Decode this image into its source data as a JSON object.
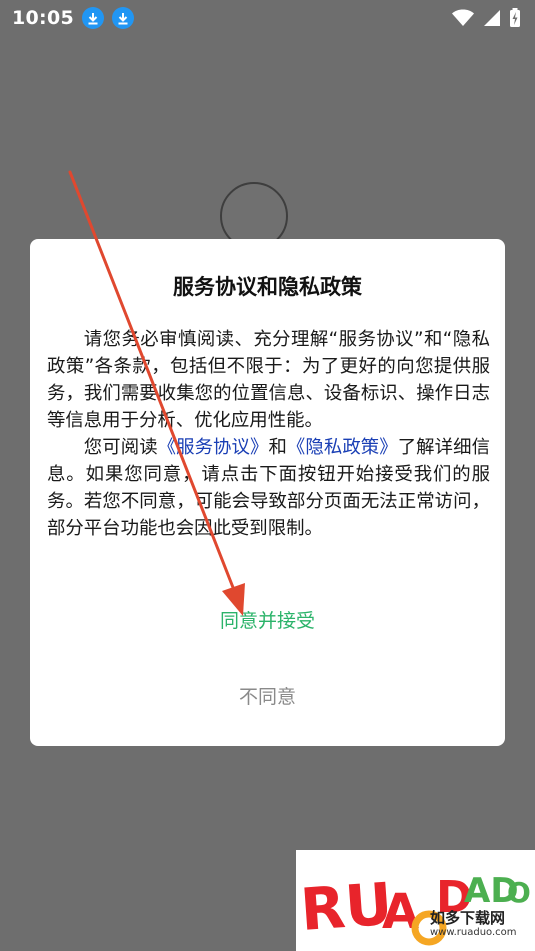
{
  "status_bar": {
    "time": "10:05",
    "left_icons": [
      "download-icon",
      "download-icon"
    ],
    "right_icons": [
      "wifi-icon",
      "signal-icon",
      "battery-charging-icon"
    ]
  },
  "dialog": {
    "title": "服务协议和隐私政策",
    "paragraph1": "请您务必审慎阅读、充分理解“服务协议”和“隐私政策”各条款，包括但不限于：为了更好的向您提供服务，我们需要收集您的位置信息、设备标识、操作日志等信息用于分析、优化应用性能。",
    "paragraph2_prefix": "您可阅读",
    "service_link": "《服务协议》",
    "paragraph2_and": "和",
    "privacy_link": "《隐私政策》",
    "paragraph2_suffix": "了解详细信息。如果您同意，请点击下面按钮开始接受我们的服务。若您不同意，可能会导致部分页面无法正常访问，部分平台功能也会因此受到限制。",
    "agree_label": "同意并接受",
    "disagree_label": "不同意"
  },
  "watermark": {
    "brand": "RUANDUO",
    "name": "如多下载网",
    "url": "www.ruaduo.com"
  },
  "colors": {
    "overlay": "#6e6e6e",
    "link": "#1a3fb5",
    "agree": "#2bb36a",
    "disagree": "#8a8a8a",
    "arrow": "#e0482f",
    "download_badge": "#2196f3"
  }
}
